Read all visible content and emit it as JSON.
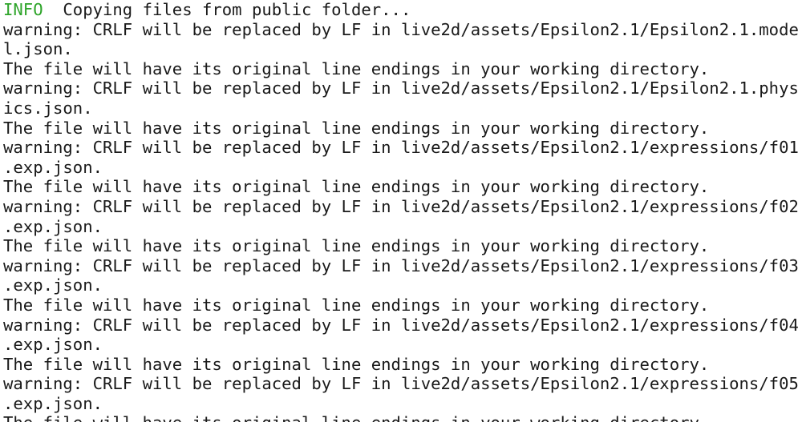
{
  "terminal": {
    "info_line": {
      "tag": "INFO",
      "message": "  Copying files from public folder..."
    },
    "lines": [
      "warning: CRLF will be replaced by LF in live2d/assets/Epsilon2.1/Epsilon2.1.mode",
      "l.json.",
      "The file will have its original line endings in your working directory.",
      "warning: CRLF will be replaced by LF in live2d/assets/Epsilon2.1/Epsilon2.1.phys",
      "ics.json.",
      "The file will have its original line endings in your working directory.",
      "warning: CRLF will be replaced by LF in live2d/assets/Epsilon2.1/expressions/f01",
      ".exp.json.",
      "The file will have its original line endings in your working directory.",
      "warning: CRLF will be replaced by LF in live2d/assets/Epsilon2.1/expressions/f02",
      ".exp.json.",
      "The file will have its original line endings in your working directory.",
      "warning: CRLF will be replaced by LF in live2d/assets/Epsilon2.1/expressions/f03",
      ".exp.json.",
      "The file will have its original line endings in your working directory.",
      "warning: CRLF will be replaced by LF in live2d/assets/Epsilon2.1/expressions/f04",
      ".exp.json.",
      "The file will have its original line endings in your working directory.",
      "warning: CRLF will be replaced by LF in live2d/assets/Epsilon2.1/expressions/f05",
      ".exp.json.",
      "The file will have its original line endings in your working directory."
    ],
    "colors": {
      "info": "#2fa52b",
      "text": "#1a1a1a",
      "background": "#ffffff"
    }
  }
}
